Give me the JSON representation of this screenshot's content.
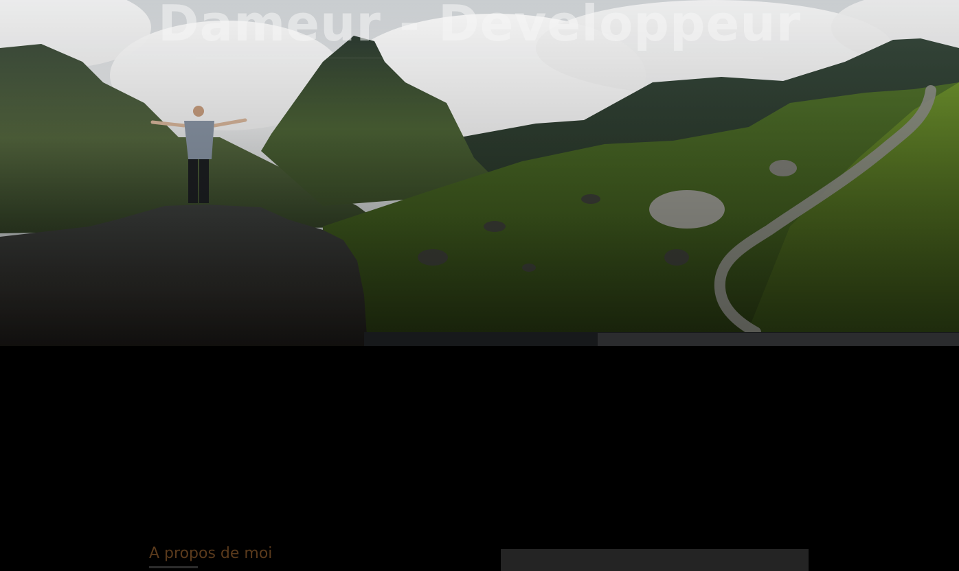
{
  "hero": {
    "title": "Dameur - Developpeur",
    "image_description_icon": "mountain-landscape-image"
  },
  "about": {
    "heading": "A propos de moi"
  },
  "colors": {
    "background": "#000000",
    "heading_accent": "#5a3a1c",
    "panel": "#242424"
  }
}
